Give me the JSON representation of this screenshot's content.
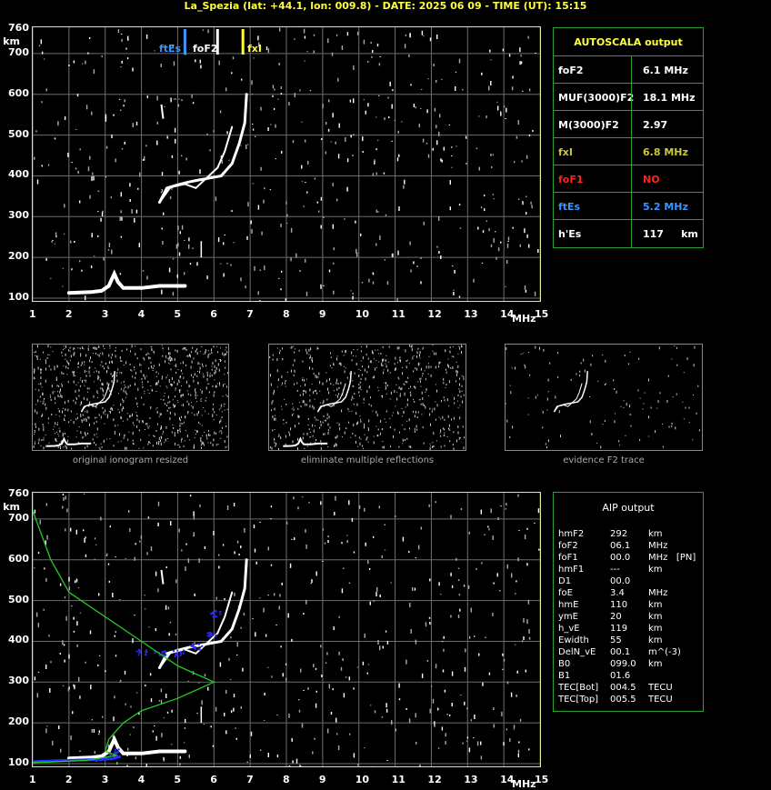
{
  "header": {
    "title": "La_Spezia (lat: +44.1, lon: 009.8) - DATE: 2025 06 09 - TIME (UT): 15:15"
  },
  "axes": {
    "y_ticks": [
      "760",
      "700",
      "600",
      "500",
      "400",
      "300",
      "200",
      "100"
    ],
    "y_unit": "km",
    "x_ticks": [
      "1",
      "2",
      "3",
      "4",
      "5",
      "6",
      "7",
      "8",
      "9",
      "10",
      "11",
      "12",
      "13",
      "14",
      "15"
    ],
    "x_unit": "MHz"
  },
  "markers": {
    "ftEs": "ftEs",
    "foF2": "foF2",
    "fxI": "fxI"
  },
  "autoscala": {
    "title": "AUTOSCALA output",
    "rows": [
      {
        "key": "foF2",
        "value": "6.1 MHz",
        "color": "#ffffff"
      },
      {
        "key": "MUF(3000)F2",
        "value": "18.1 MHz",
        "color": "#ffffff"
      },
      {
        "key": "M(3000)F2",
        "value": "2.97",
        "color": "#ffffff"
      },
      {
        "key": "fxI",
        "value": "6.8 MHz",
        "color": "#c8c83c"
      },
      {
        "key": "foF1",
        "value": "NO",
        "color": "#ff2020"
      },
      {
        "key": "ftEs",
        "value": "5.2 MHz",
        "color": "#3c96ff"
      },
      {
        "key": "h'Es",
        "value": "117     km",
        "color": "#ffffff"
      }
    ]
  },
  "thumbs": {
    "cap1": "original ionogram resized",
    "cap2": "eliminate multiple reflections",
    "cap3": "evidence F2 trace"
  },
  "aip": {
    "title": "AIP output",
    "rows": [
      {
        "k": "hmF2",
        "v": "292",
        "u": "km"
      },
      {
        "k": "foF2",
        "v": "06.1",
        "u": "MHz"
      },
      {
        "k": "foF1",
        "v": "00.0",
        "u": "MHz   [PN]"
      },
      {
        "k": "hmF1",
        "v": "---",
        "u": "km"
      },
      {
        "k": "D1",
        "v": "00.0",
        "u": ""
      },
      {
        "k": "foE",
        "v": "3.4",
        "u": "MHz"
      },
      {
        "k": "hmE",
        "v": "110",
        "u": "km"
      },
      {
        "k": "ymE",
        "v": "20",
        "u": "km"
      },
      {
        "k": "h_vE",
        "v": "119",
        "u": "km"
      },
      {
        "k": "Ewidth",
        "v": "55",
        "u": "km"
      },
      {
        "k": "DelN_vE",
        "v": "00.1",
        "u": "m^(-3)"
      },
      {
        "k": "B0",
        "v": "099.0",
        "u": "km"
      },
      {
        "k": "B1",
        "v": "01.6",
        "u": ""
      },
      {
        "k": "TEC[Bot]",
        "v": "004.5",
        "u": "TECU"
      },
      {
        "k": "TEC[Top]",
        "v": "005.5",
        "u": "TECU"
      }
    ]
  },
  "colors": {
    "grid": "#6e6e6e",
    "frame": "#e6e6a0",
    "green": "#2aa12a",
    "trace": "#ffffff",
    "blue": "#2a2aff",
    "profile": "#22cc22"
  }
}
